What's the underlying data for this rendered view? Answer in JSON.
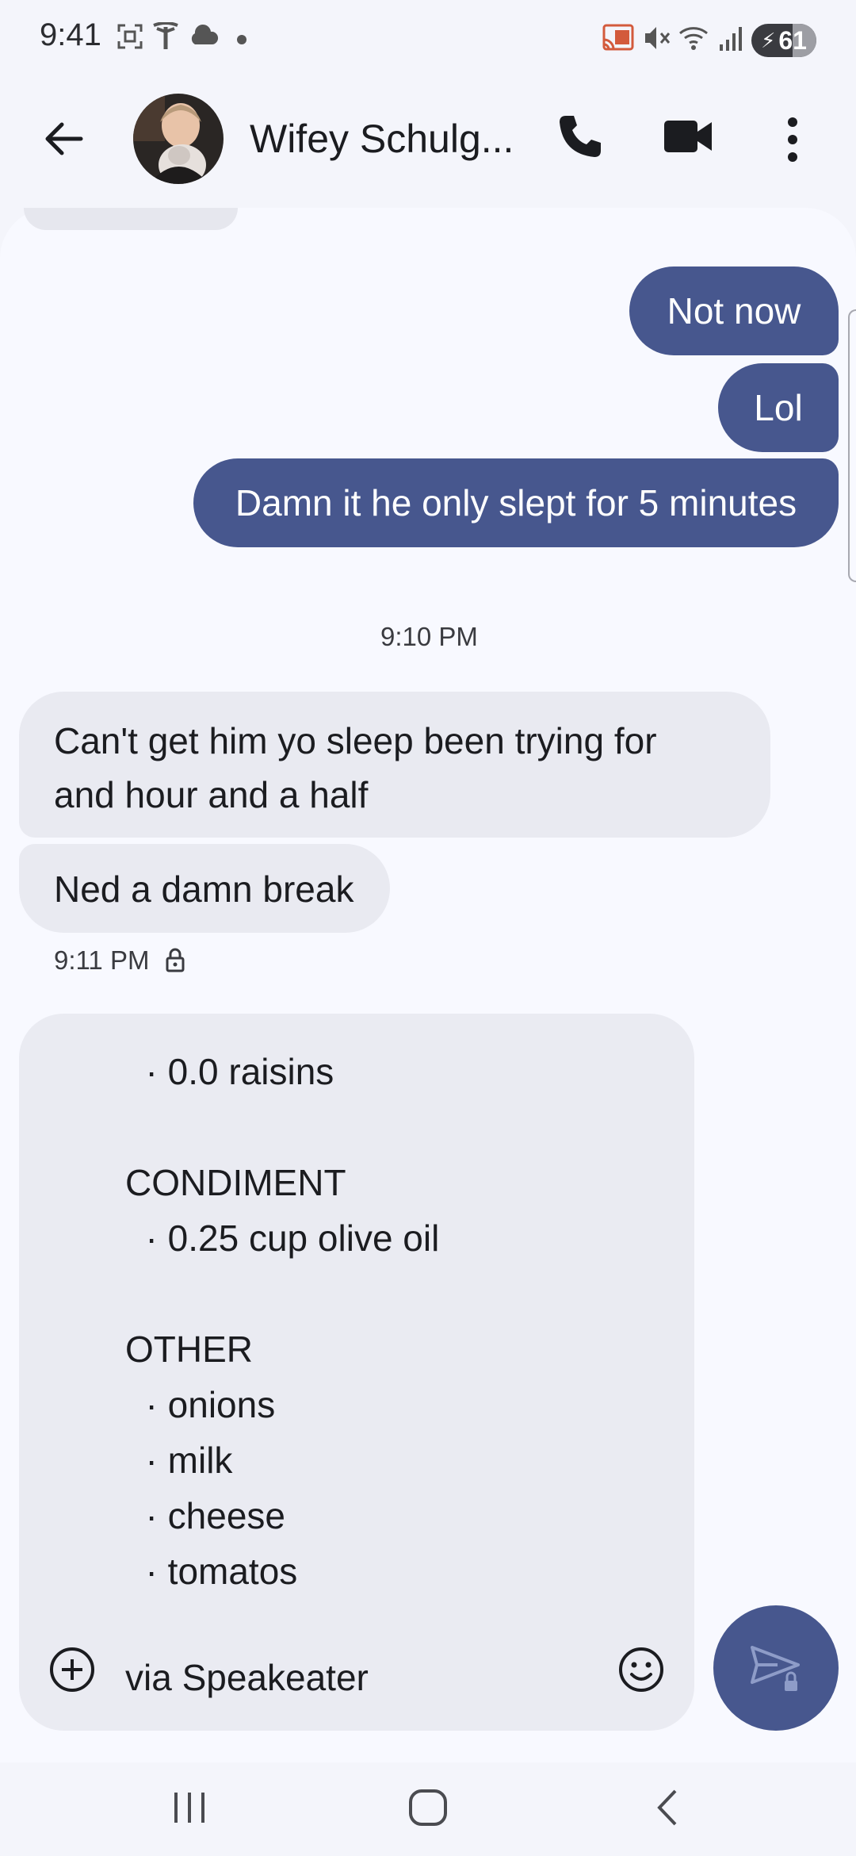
{
  "status_bar": {
    "time": "9:41",
    "battery": "61"
  },
  "header": {
    "contact_name": "Wifey Schulg..."
  },
  "messages": [
    {
      "text": "Not now"
    },
    {
      "text": "Lol"
    },
    {
      "text": "Damn it he only slept for 5 minutes"
    },
    {
      "timestamp": "9:10 PM"
    },
    {
      "text_line1": "Can't get him yo sleep been trying for",
      "text_line2": "and hour and a half"
    },
    {
      "text": "Ned a damn break"
    },
    {
      "timestamp": "9:11 PM"
    }
  ],
  "compose": {
    "lines": [
      "  · 0.0 raisins",
      "",
      "CONDIMENT",
      "  · 0.25 cup olive oil",
      "",
      "OTHER",
      "  · onions",
      "  · milk",
      "  · cheese",
      "  · tomatos"
    ],
    "input_text": "via Speakeater"
  },
  "colors": {
    "outgoing_bubble": "#47578e",
    "incoming_bubble": "#e9eaf1",
    "background": "#f8f9ff"
  },
  "icons": {
    "back": "arrow-left",
    "call": "phone",
    "video": "video-camera",
    "more": "vertical-dots",
    "add": "plus-circle",
    "emoji": "smiley",
    "send": "send-lock"
  }
}
